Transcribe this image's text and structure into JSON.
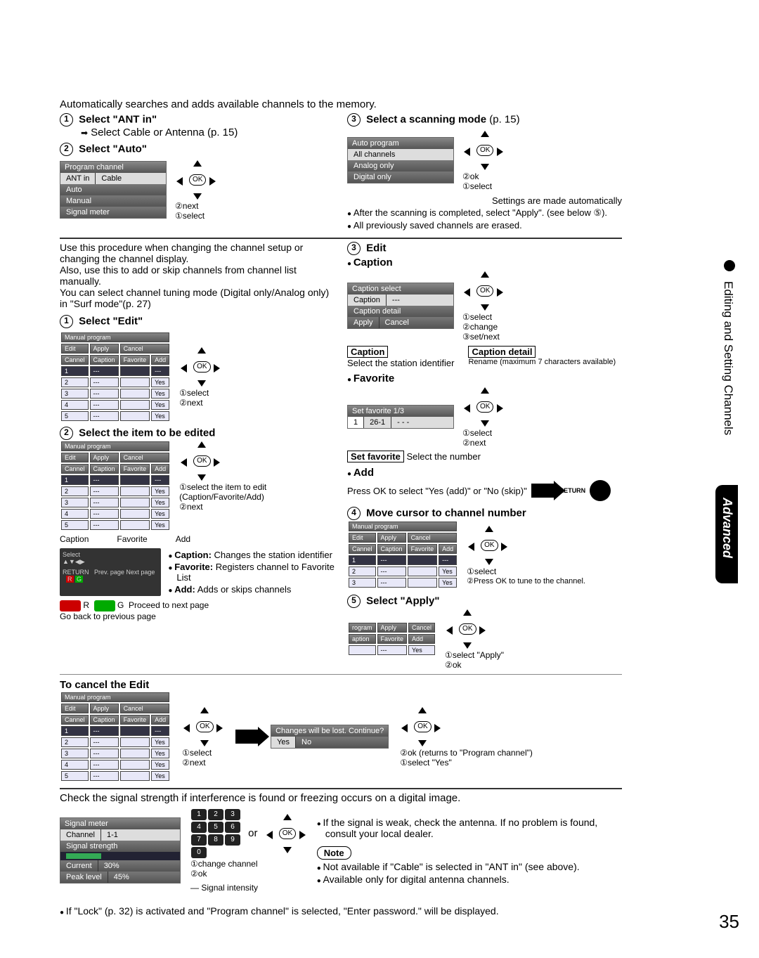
{
  "page_number": "35",
  "side_label": "Editing and Setting Channels",
  "adv_label": "Advanced",
  "footnote": "If \"Lock\" (p. 32) is activated and \"Program channel\" is selected, \"Enter password.\" will be displayed.",
  "intro": "Automatically searches and adds available channels to the memory.",
  "step_antin_title": "Select \"ANT in\"",
  "step_antin_sub": "Select Cable or Antenna (p. 15)",
  "step_auto_title": "Select \"Auto\"",
  "prog_menu": {
    "title": "Program channel",
    "rows": [
      [
        "ANT in",
        "Cable"
      ],
      [
        "Auto",
        ""
      ],
      [
        "Manual",
        ""
      ],
      [
        "Signal meter",
        ""
      ]
    ]
  },
  "anno_next": "next",
  "anno_select": "select",
  "anno_change": "change",
  "anno_ok": "ok",
  "anno_setnext": "set/next",
  "step_scan_title": "Select a scanning mode",
  "step_scan_page": "(p. 15)",
  "auto_menu": {
    "title": "Auto program",
    "rows": [
      [
        "All channels"
      ],
      [
        "Analog only"
      ],
      [
        "Digital only"
      ]
    ]
  },
  "scan_notes": [
    "Settings are made automatically",
    "After the scanning is completed, select \"Apply\". (see below ⑤).",
    "All previously saved channels are erased."
  ],
  "manual_intro": [
    "Use this procedure when changing the channel setup or changing the channel display.",
    "Also, use this to add or skip channels from channel list manually.",
    "You can select channel tuning mode (Digital only/Analog only) in \"Surf mode\"(p. 27)"
  ],
  "step_edit_title": "Select \"Edit\"",
  "manual_tbl": {
    "title": "Manual program",
    "tabs": [
      "Edit",
      "Apply",
      "Cancel"
    ],
    "headers": [
      "Cannel",
      "Caption",
      "Favorite",
      "Add"
    ],
    "rows": [
      [
        "1",
        "---",
        "",
        "---"
      ],
      [
        "2",
        "---",
        "",
        "Yes"
      ],
      [
        "3",
        "---",
        "",
        "Yes"
      ],
      [
        "4",
        "---",
        "",
        "Yes"
      ],
      [
        "5",
        "---",
        "",
        "Yes"
      ]
    ]
  },
  "step_item_title": "Select the item to be edited",
  "item_anno": "select the item to edit (Caption/Favorite/Add)",
  "labels_fav": "Favorite",
  "labels_cap": "Caption",
  "labels_add": "Add",
  "tips": [
    {
      "t": "Caption:",
      "d": "Changes the station identifier"
    },
    {
      "t": "Favorite:",
      "d": "Registers channel to Favorite List"
    },
    {
      "t": "Add:",
      "d": "Adds or skips channels"
    }
  ],
  "legend_back": "Go back to previous page",
  "legend_next": "Proceed to next page",
  "legend_r": "R",
  "legend_g": "G",
  "footer_row": "Prev. page    Next page",
  "cancel_title": "To cancel the Edit",
  "cancel_dialog": {
    "title": "Changes will be lost. Continue?",
    "yes": "Yes",
    "no": "No"
  },
  "cancel_anno": [
    "ok (returns to \"Program channel\")",
    "select \"Yes\""
  ],
  "right_edit_h": "Edit",
  "right_caption_h": "Caption",
  "caption_menu": {
    "title": "Caption select",
    "rows": [
      [
        "Caption",
        "---"
      ],
      [
        "Caption detail",
        ""
      ],
      [
        "Apply",
        "Cancel"
      ]
    ]
  },
  "caption_box": "Caption",
  "caption_box_desc": "Select the station identifier",
  "caption_det_box": "Caption detail",
  "caption_det_desc": "Rename (maximum 7 characters available)",
  "favorite_h": "Favorite",
  "fav_menu": {
    "title": "Set favorite        1/3",
    "row": [
      "1",
      "26-1",
      "- - -"
    ]
  },
  "setfav_box": "Set favorite",
  "setfav_desc": "Select the number",
  "add_h": "Add",
  "add_desc": "Press OK to select \"Yes (add)\" or \"No (skip)\"",
  "return_lbl": "RETURN",
  "step_move_title": "Move cursor to channel number",
  "move_anno": "Press OK to tune to the channel.",
  "step_apply_title": "Select \"Apply\"",
  "apply_anno": "select \"Apply\"",
  "signal_intro": "Check the signal strength if interference is found or freezing occurs on a digital image.",
  "sig_menu": {
    "title": "Signal meter",
    "rows": [
      [
        "Channel",
        "1-1"
      ],
      [
        "Signal strength",
        ""
      ],
      [
        "Current",
        "30%"
      ],
      [
        "Peak level",
        "45%"
      ]
    ]
  },
  "sig_si": "Signal intensity",
  "change_channel": "change channel",
  "or": "or",
  "sig_notes_top": [
    "If the signal is weak, check the antenna. If no problem is found, consult your local dealer."
  ],
  "note_box": "Note",
  "sig_notes_btm": [
    "Not available if \"Cable\" is selected in \"ANT in\" (see above).",
    "Available only for digital antenna channels."
  ],
  "keypad": [
    "1",
    "2",
    "3",
    "4",
    "5",
    "6",
    "7",
    "8",
    "9",
    "0"
  ]
}
